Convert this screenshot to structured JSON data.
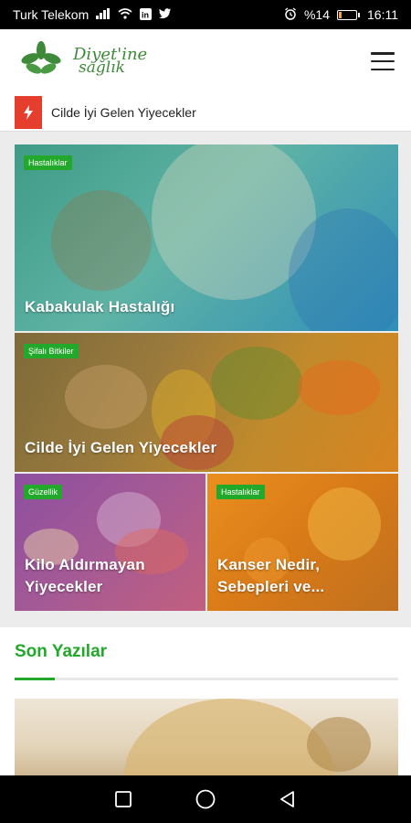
{
  "status_bar": {
    "carrier": "Turk Telekom",
    "battery_percent": "%14",
    "time": "16:11",
    "battery_level": 0.14,
    "icons": [
      "signal-icon",
      "wifi-icon",
      "linkedin-icon",
      "twitter-icon",
      "alarm-icon",
      "battery-icon"
    ]
  },
  "header": {
    "logo_line1": "Diyet'ine",
    "logo_line2": "sağlık",
    "menu_icon": "hamburger-menu-icon"
  },
  "ticker": {
    "icon": "lightning-icon",
    "text": "Cilde İyi Gelen Yiyecekler"
  },
  "featured": [
    {
      "category": "Hastalıklar",
      "title": "Kabakulak Hastalığı"
    },
    {
      "category": "Şifalı Bitkiler",
      "title": "Cilde İyi Gelen Yiyecekler"
    },
    {
      "category": "Güzellik",
      "title": "Kilo Aldırmayan Yiyecekler"
    },
    {
      "category": "Hastalıklar",
      "title": "Kanser Nedir, Sebepleri ve..."
    }
  ],
  "recent": {
    "title": "Son Yazılar"
  },
  "nav": {
    "icons": [
      "square-recents-icon",
      "circle-home-icon",
      "triangle-back-icon"
    ]
  },
  "colors": {
    "accent_green": "#22a82a",
    "ticker_red": "#e53e2c",
    "logo_green": "#3f8a3a"
  }
}
